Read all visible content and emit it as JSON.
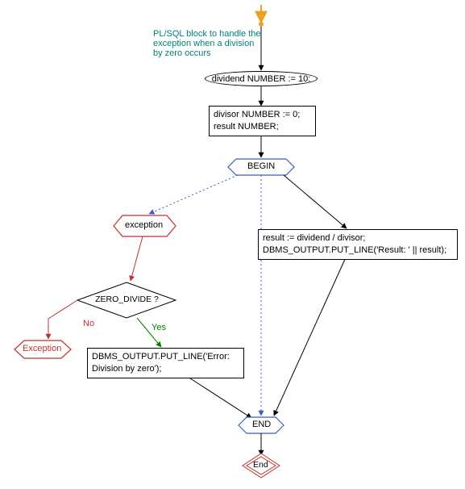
{
  "annotation": "PL/SQL block to handle the\nexception when a division\nby zero occurs",
  "ellipse_dividend": "dividend NUMBER := 10;",
  "box_divisor": "divisor  NUMBER := 0;\nresult NUMBER;",
  "hex_begin": "BEGIN",
  "hex_exception": "exception",
  "diamond_zero": "ZERO_DIVIDE ?",
  "label_yes": "Yes",
  "label_no": "No",
  "hex_exc_bottom": "Exception",
  "box_dbms_error": "DBMS_OUTPUT.PUT_LINE('Error:\nDivision by zero');",
  "box_result": "result := dividend / divisor;\nDBMS_OUTPUT.PUT_LINE('Result: ' || result);",
  "hex_end": "END",
  "diamond_end": "End",
  "colors": {
    "teal": "#008080",
    "blue": "#3b5fc0",
    "red": "#c03030",
    "green": "#008000",
    "orange": "#f0a020"
  }
}
